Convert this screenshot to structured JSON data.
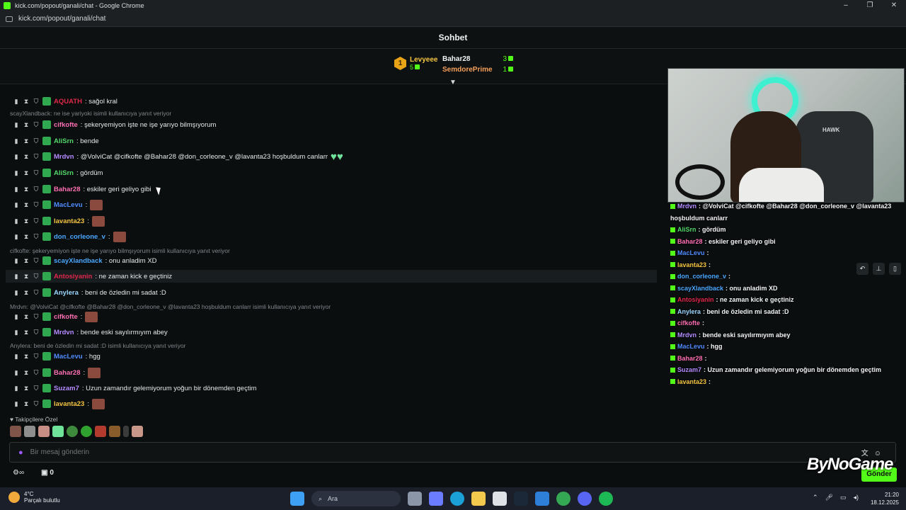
{
  "window": {
    "title": "kick.com/popout/ganali/chat - Google Chrome",
    "url": "kick.com/popout/ganali/chat",
    "controls": [
      "–",
      "❐",
      "✕"
    ]
  },
  "header": {
    "title": "Sohbet"
  },
  "leaderboard": {
    "first": {
      "rank": "1",
      "name": "Levyeee",
      "count": "5"
    },
    "others": [
      {
        "name": "Bahar28",
        "count": "3",
        "color": "#f2f4f5"
      },
      {
        "name": "SemdorePrime",
        "count": "1",
        "color": "#f5a05a"
      }
    ]
  },
  "chat": {
    "messages": [
      {
        "user": "AQUATH",
        "color": "#e0284a",
        "text": ": sağol kral"
      },
      {
        "reply": "scayXlandback: ne ise yariyoki isimli kullanıcıya yanıt veriyor"
      },
      {
        "user": "cifkofte",
        "color": "#ff6fb3",
        "text": ": şekeryemiyon işte ne işe yarıyo bilmşıyorum"
      },
      {
        "user": "AliSrn",
        "color": "#53d86a",
        "text": ": bende"
      },
      {
        "user": "Mrdvn",
        "color": "#b48cff",
        "text": ": @VolviCat @cifkofte @Bahar28 @don_corleone_v @lavanta23 hoşbuldum canlarr"
      },
      {
        "user": "AliSrn",
        "color": "#53d86a",
        "text": ": gördüm"
      },
      {
        "user": "Bahar28",
        "color": "#ff6fb3",
        "text": ": eskiler geri geliyo gibi"
      },
      {
        "user": "MacLevu",
        "color": "#4f8cff",
        "text": ":"
      },
      {
        "user": "lavanta23",
        "color": "#f5c542",
        "text": ":"
      },
      {
        "user": "don_corleone_v",
        "color": "#4aa8ff",
        "text": ":"
      },
      {
        "reply": "cifkofte: şekeryemiyon işte ne işe yarıyo bilmşıyorum isimli kullanıcıya yanıt veriyor"
      },
      {
        "user": "scayXlandback",
        "color": "#4aa8ff",
        "text": ": onu anladim XD"
      },
      {
        "user": "Antosiyanin",
        "color": "#e0284a",
        "text": ": ne zaman kick e geçtiniz"
      },
      {
        "user": "Anylera",
        "color": "#9ad7ff",
        "text": ": beni de özledin mi sadat :D"
      },
      {
        "reply": "Mrdvn: @VolviCat @cifkofte @Bahar28 @don_corleone_v @lavanta23 hoşbuldum canlarr isimli kullanıcıya yanıt veriyor"
      },
      {
        "user": "cifkofte",
        "color": "#ff6fb3",
        "text": ":"
      },
      {
        "user": "Mrdvn",
        "color": "#b48cff",
        "text": ": bende eski sayılırmıyım abey"
      },
      {
        "reply": "Anylera: beni de özledin mi sadat :D isimli kullanıcıya yanıt veriyor"
      },
      {
        "user": "MacLevu",
        "color": "#4f8cff",
        "text": ": hgg"
      },
      {
        "user": "Bahar28",
        "color": "#ff6fb3",
        "text": ":"
      },
      {
        "user": "Suzam7",
        "color": "#b48cff",
        "text": ": Uzun zamandır gelemiyorum yoğun bir dönemden geçtim"
      },
      {
        "user": "lavanta23",
        "color": "#f5c542",
        "text": ":"
      }
    ]
  },
  "followers_label": "Takipçilere Özel",
  "input": {
    "placeholder": "Bir mesaj gönderin"
  },
  "footer": {
    "points": "0",
    "send_label": "Gönder"
  },
  "overlay": {
    "cam_brand": "HAWK",
    "lines": [
      {
        "user": "Mrdvn",
        "color": "#b48cff",
        "text": ": @VolviCat @cifkofte @Bahar28 @don_corleone_v @lavanta23"
      },
      {
        "user": "",
        "color": "#f2f4f5",
        "text": "hoşbuldum canlarr"
      },
      {
        "user": "AliSrn",
        "color": "#53d86a",
        "text": ": gördüm"
      },
      {
        "user": "Bahar28",
        "color": "#ff6fb3",
        "text": ": eskiler geri geliyo gibi"
      },
      {
        "user": "MacLevu",
        "color": "#4f8cff",
        "text": ":"
      },
      {
        "user": "lavanta23",
        "color": "#f5c542",
        "text": ":"
      },
      {
        "user": "don_corleone_v",
        "color": "#4aa8ff",
        "text": ":"
      },
      {
        "user": "scayXlandback",
        "color": "#4aa8ff",
        "text": ": onu anladim XD"
      },
      {
        "user": "Antosiyanin",
        "color": "#e0284a",
        "text": ": ne zaman kick e geçtiniz"
      },
      {
        "user": "Anylera",
        "color": "#9ad7ff",
        "text": ": beni de özledin mi sadat :D"
      },
      {
        "user": "cifkofte",
        "color": "#ff6fb3",
        "text": ":"
      },
      {
        "user": "Mrdvn",
        "color": "#b48cff",
        "text": ": bende eski sayılırmıyım abey"
      },
      {
        "user": "MacLevu",
        "color": "#4f8cff",
        "text": ": hgg"
      },
      {
        "user": "Bahar28",
        "color": "#ff6fb3",
        "text": ":"
      },
      {
        "user": "Suzam7",
        "color": "#b48cff",
        "text": ": Uzun zamandır gelemiyorum yoğun bir dönemden geçtim"
      },
      {
        "user": "lavanta23",
        "color": "#f5c542",
        "text": ":"
      }
    ],
    "watermark": "ByNoGame"
  },
  "taskbar": {
    "weather_temp": "4°C",
    "weather_desc": "Parçalı bulutlu",
    "search_label": "Ara",
    "time": "21:20",
    "date": "18.12.2025"
  },
  "colors": {
    "accent": "#53fc18",
    "background": "#0b0e0f"
  }
}
